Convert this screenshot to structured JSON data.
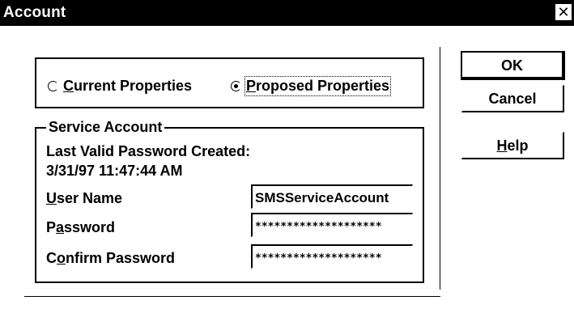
{
  "window": {
    "title": "Account",
    "close_glyph": "✕"
  },
  "properties": {
    "current_label_accel": "C",
    "current_label_rest": "urrent Properties",
    "proposed_label_accel": "P",
    "proposed_label_rest": "roposed Properties",
    "selected": "proposed"
  },
  "service_account": {
    "legend": "Service Account",
    "last_valid_label": "Last Valid Password Created:",
    "last_valid_value": "3/31/97 11:47:44 AM",
    "user_name_accel": "U",
    "user_name_rest": "ser Name",
    "user_name_value": "SMSServiceAccount",
    "password_pre": "P",
    "password_accel": "a",
    "password_rest": "ssword",
    "password_value": "********************",
    "confirm_pre": "C",
    "confirm_accel": "o",
    "confirm_rest": "nfirm Password",
    "confirm_value": "********************"
  },
  "buttons": {
    "ok": "OK",
    "cancel": "Cancel",
    "help_accel": "H",
    "help_rest": "elp"
  }
}
